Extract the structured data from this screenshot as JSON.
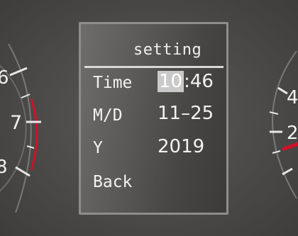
{
  "menu": {
    "title": "setting",
    "rows": [
      {
        "label": "Time",
        "value_hour": "10",
        "value_sep": ":",
        "value_min": "46"
      },
      {
        "label": "M/D",
        "value": "11–25"
      },
      {
        "label": "Y",
        "value": "2019"
      },
      {
        "label": "Back"
      }
    ]
  },
  "left_gauge": {
    "labels": [
      "6",
      "7",
      "8"
    ]
  },
  "right_gauge": {
    "labels": [
      "4",
      "2"
    ]
  },
  "colors": {
    "redline": "#d0112b",
    "panel_border": "#8e8d8b",
    "text": "#f2f2f2",
    "highlight": "#c9c9c9"
  }
}
